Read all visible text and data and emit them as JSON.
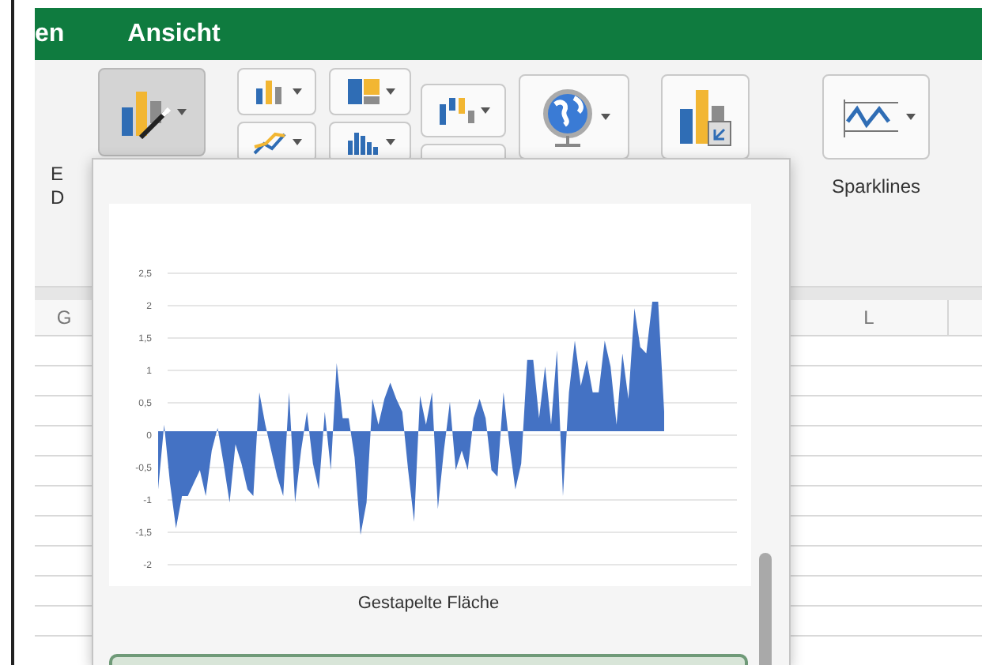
{
  "ribbon_tabs": [
    {
      "label": "en",
      "selected": false
    },
    {
      "label": "Ansicht",
      "selected": false
    }
  ],
  "chart_buttons": [
    {
      "pressed": true
    },
    {
      "pressed": false
    },
    {
      "pressed": false
    },
    {
      "pressed": false
    },
    {
      "pressed": false
    },
    {
      "pressed": false
    },
    {
      "pressed": false
    },
    {
      "pressed": false
    },
    {
      "pressed": false
    },
    {
      "pressed": false,
      "label": "Sparklines"
    }
  ],
  "cut_labels": [
    "E",
    "D"
  ],
  "column_headers": [
    "G",
    "L"
  ],
  "chart_gallery": {
    "preview": {
      "axis_labels": [
        "2,5",
        "2",
        "1,5",
        "1",
        "0,5",
        "0",
        "-0,5",
        "-1",
        "-1,5",
        "-2"
      ],
      "caption": "Gestapelte Fläche",
      "selected": false
    },
    "next_item": {
      "selected": true
    }
  }
}
